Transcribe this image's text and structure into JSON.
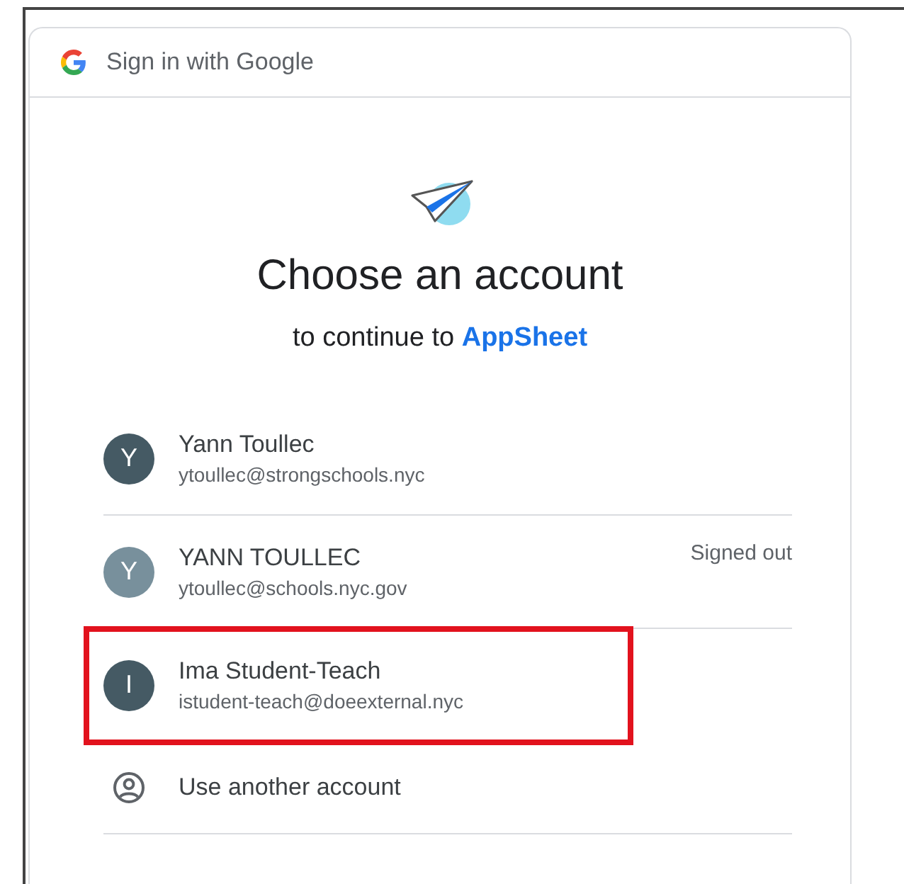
{
  "header": {
    "title": "Sign in with Google"
  },
  "heading": "Choose an account",
  "subtitle": {
    "text": "to continue to",
    "app": "AppSheet"
  },
  "accounts": [
    {
      "kind": "account",
      "initial": "Y",
      "name": "Yann Toullec",
      "email": "ytoullec@strongschools.nyc",
      "color": "#455a64",
      "highlighted": false
    },
    {
      "kind": "account",
      "initial": "Y",
      "name": "YANN TOULLEC",
      "email": "ytoullec@schools.nyc.gov",
      "color": "#78909c",
      "status": "Signed out",
      "highlighted": false
    },
    {
      "kind": "account",
      "initial": "I",
      "name": "Ima Student-Teach",
      "email": "istudent-teach@doeexternal.nyc",
      "color": "#455a64",
      "highlighted": true
    },
    {
      "kind": "other",
      "name": "Use another account",
      "highlighted": false
    }
  ]
}
